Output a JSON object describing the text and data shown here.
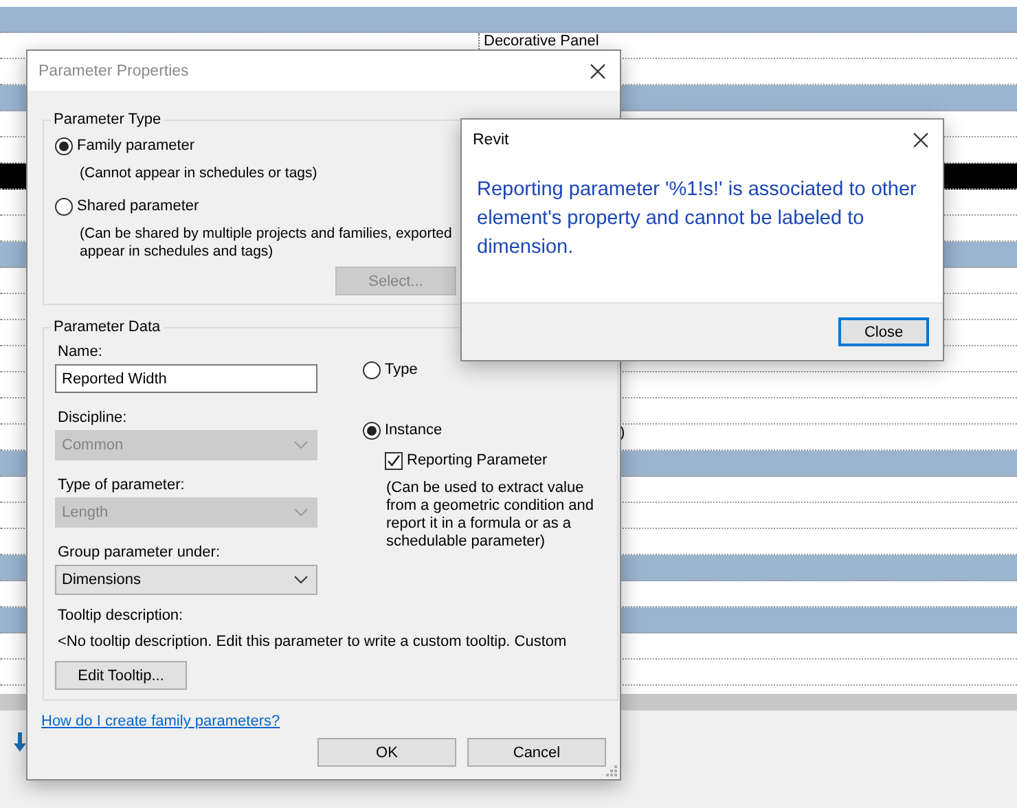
{
  "background_table": {
    "rows": [
      {
        "selected": true,
        "focused": false
      },
      {
        "selected": false,
        "focused": false,
        "column_2": "Decorative Panel"
      },
      {
        "selected": false,
        "focused": false
      },
      {
        "selected": true,
        "focused": false
      },
      {
        "selected": false,
        "focused": false
      },
      {
        "selected": false,
        "focused": false
      },
      {
        "selected": false,
        "focused": true
      },
      {
        "selected": false,
        "focused": false
      },
      {
        "selected": false,
        "focused": false
      },
      {
        "selected": true,
        "focused": false
      },
      {
        "selected": false,
        "focused": false
      },
      {
        "selected": false,
        "focused": false
      },
      {
        "selected": false,
        "focused": false
      },
      {
        "selected": false,
        "focused": false
      },
      {
        "selected": false,
        "focused": false
      },
      {
        "selected": false,
        "focused": false
      },
      {
        "selected": false,
        "focused": false,
        "column_3": ")"
      },
      {
        "selected": true,
        "focused": false
      },
      {
        "selected": false,
        "focused": false
      },
      {
        "selected": false,
        "focused": false
      },
      {
        "selected": false,
        "focused": false
      },
      {
        "selected": true,
        "focused": false
      },
      {
        "selected": false,
        "focused": false
      },
      {
        "selected": true,
        "focused": false
      },
      {
        "selected": false,
        "focused": false
      },
      {
        "selected": false,
        "focused": false
      }
    ]
  },
  "parameter_properties_dialog": {
    "title": "Parameter Properties",
    "parameter_type": {
      "title": "Parameter Type",
      "options": [
        {
          "label": "Family parameter",
          "selected": true,
          "hint": [
            "(Cannot appear in schedules or tags)"
          ]
        },
        {
          "label": "Shared parameter",
          "selected": false,
          "hint": [
            "(Can be shared by multiple projects and families, exported",
            "appear in schedules and tags)"
          ]
        }
      ],
      "select_button": {
        "label": "Select...",
        "disabled": true
      }
    },
    "parameter_data": {
      "title": "Parameter Data",
      "name": {
        "label": "Name:",
        "value": "Reported Width"
      },
      "dropdowns": [
        {
          "label": "Discipline:",
          "value": "Common",
          "disabled": true
        },
        {
          "label": "Type of parameter:",
          "value": "Length",
          "disabled": true
        },
        {
          "label": "Group parameter under:",
          "value": "Dimensions",
          "disabled": false
        }
      ],
      "scope": [
        {
          "label": "Type",
          "selected": false
        },
        {
          "label": "Instance",
          "selected": true
        }
      ],
      "reporting": {
        "label": "Reporting Parameter",
        "checked": true,
        "description": "(Can be used to extract value from a geometric condition and report it in a formula or as a schedulable parameter)"
      },
      "tooltip": {
        "label": "Tooltip description:",
        "text": "<No tooltip description. Edit this parameter to write a custom tooltip. Custom",
        "button": "Edit Tooltip..."
      }
    },
    "help_link": "How do I create family parameters?",
    "buttons": [
      "OK",
      "Cancel"
    ]
  },
  "message_dialog": {
    "title": "Revit",
    "message": "Reporting parameter '%1!s!' is associated to other element's property and cannot be labeled to dimension.",
    "button": "Close"
  }
}
